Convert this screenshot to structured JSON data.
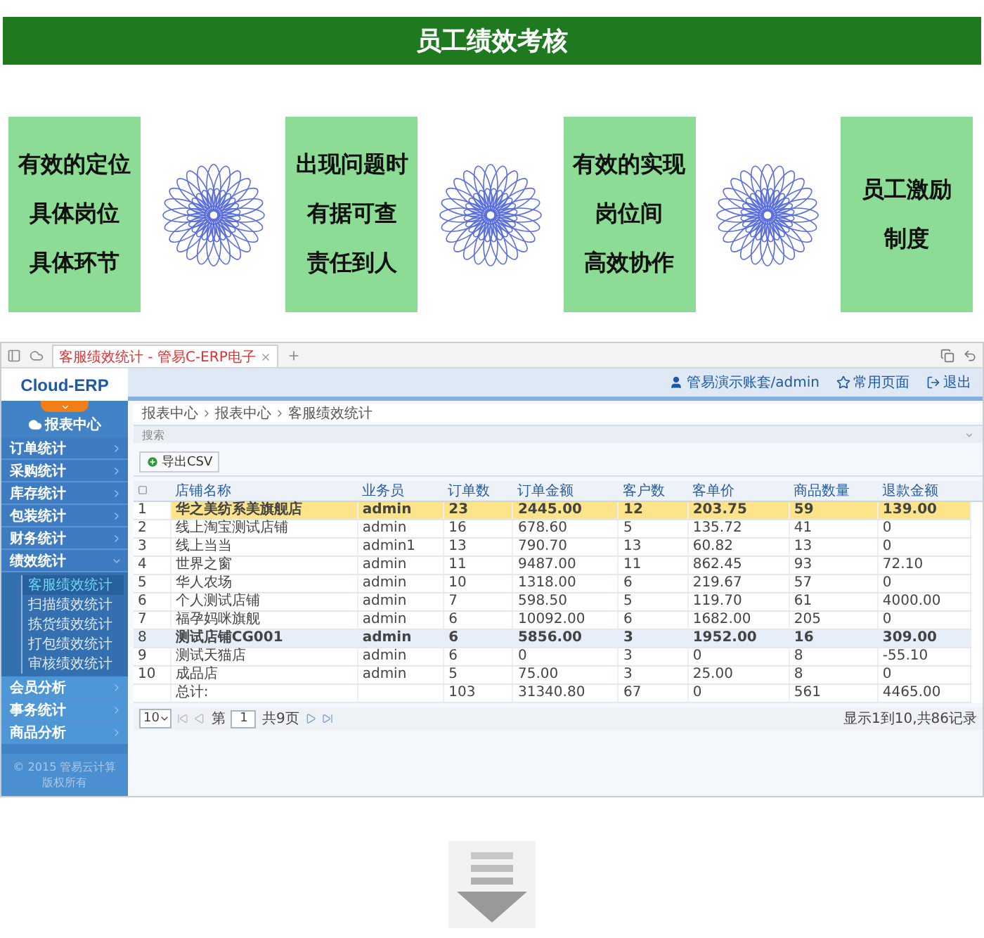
{
  "banner": {
    "title": "员工绩效考核"
  },
  "cards": [
    {
      "lines": [
        "有效的定位",
        "具体岗位",
        "具体环节"
      ]
    },
    {
      "lines": [
        "出现问题时",
        "有据可查",
        "责任到人"
      ]
    },
    {
      "lines": [
        "有效的实现",
        "岗位间",
        "高效协作"
      ]
    },
    {
      "lines": [
        "员工激励",
        "制度"
      ]
    }
  ],
  "erp": {
    "browser": {
      "tab_title": "客服绩效统计 - 管易C-ERP电子"
    },
    "logo": "Cloud-ERP",
    "header_links": [
      {
        "kind": "user",
        "label": "管易演示账套/admin"
      },
      {
        "kind": "favorites",
        "label": "常用页面"
      },
      {
        "kind": "logout",
        "label": "退出"
      }
    ],
    "sidebar": {
      "title": "报表中心",
      "items": [
        {
          "label": "订单统计",
          "expanded": false
        },
        {
          "label": "采购统计",
          "expanded": false
        },
        {
          "label": "库存统计",
          "expanded": false
        },
        {
          "label": "包装统计",
          "expanded": false
        },
        {
          "label": "财务统计",
          "expanded": false
        },
        {
          "label": "绩效统计",
          "expanded": true,
          "children": [
            {
              "label": "客服绩效统计",
              "selected": true
            },
            {
              "label": "扫描绩效统计",
              "selected": false
            },
            {
              "label": "拣货绩效统计",
              "selected": false
            },
            {
              "label": "打包绩效统计",
              "selected": false
            },
            {
              "label": "审核绩效统计",
              "selected": false
            }
          ]
        },
        {
          "label": "会员分析",
          "expanded": false
        },
        {
          "label": "事务统计",
          "expanded": false
        },
        {
          "label": "商品分析",
          "expanded": false
        }
      ],
      "footer": [
        "© 2015 管易云计算",
        "版权所有"
      ]
    },
    "breadcrumb": [
      "报表中心",
      "报表中心",
      "客服绩效统计"
    ],
    "search_label": "搜索",
    "export_button": "导出CSV",
    "table": {
      "columns": [
        "店铺名称",
        "业务员",
        "订单数",
        "订单金额",
        "客户数",
        "客单价",
        "商品数量",
        "退款金额"
      ],
      "rows": [
        {
          "index": "1",
          "cells": [
            "华之美纺系美旗舰店",
            "admin",
            "23",
            "2445.00",
            "12",
            "203.75",
            "59",
            "139.00"
          ],
          "selected": true,
          "hovered": false
        },
        {
          "index": "2",
          "cells": [
            "线上淘宝测试店铺",
            "admin",
            "16",
            "678.60",
            "5",
            "135.72",
            "41",
            "0"
          ],
          "selected": false,
          "hovered": false
        },
        {
          "index": "3",
          "cells": [
            "线上当当",
            "admin1",
            "13",
            "790.70",
            "13",
            "60.82",
            "13",
            "0"
          ],
          "selected": false,
          "hovered": false
        },
        {
          "index": "4",
          "cells": [
            "世界之窗",
            "admin",
            "11",
            "9487.00",
            "11",
            "862.45",
            "93",
            "72.10"
          ],
          "selected": false,
          "hovered": false
        },
        {
          "index": "5",
          "cells": [
            "华人农场",
            "admin",
            "10",
            "1318.00",
            "6",
            "219.67",
            "57",
            "0"
          ],
          "selected": false,
          "hovered": false
        },
        {
          "index": "6",
          "cells": [
            "个人测试店铺",
            "admin",
            "7",
            "598.50",
            "5",
            "119.70",
            "61",
            "4000.00"
          ],
          "selected": false,
          "hovered": false
        },
        {
          "index": "7",
          "cells": [
            "福孕妈咪旗舰",
            "admin",
            "6",
            "10092.00",
            "6",
            "1682.00",
            "205",
            "0"
          ],
          "selected": false,
          "hovered": false
        },
        {
          "index": "8",
          "cells": [
            "测试店铺CG001",
            "admin",
            "6",
            "5856.00",
            "3",
            "1952.00",
            "16",
            "309.00"
          ],
          "selected": false,
          "hovered": true
        },
        {
          "index": "9",
          "cells": [
            "测试天猫店",
            "admin",
            "6",
            "0",
            "3",
            "0",
            "8",
            "-55.10"
          ],
          "selected": false,
          "hovered": false
        },
        {
          "index": "10",
          "cells": [
            "成品店",
            "admin",
            "5",
            "75.00",
            "3",
            "25.00",
            "8",
            "0"
          ],
          "selected": false,
          "hovered": false
        }
      ],
      "total": {
        "label": "总计:",
        "cells": [
          "",
          "103",
          "31340.80",
          "67",
          "0",
          "561",
          "4465.00"
        ]
      }
    },
    "pager": {
      "page_size": "10",
      "before": "第",
      "page": "1",
      "after": "共9页",
      "summary": "显示1到10,共86记录"
    }
  }
}
